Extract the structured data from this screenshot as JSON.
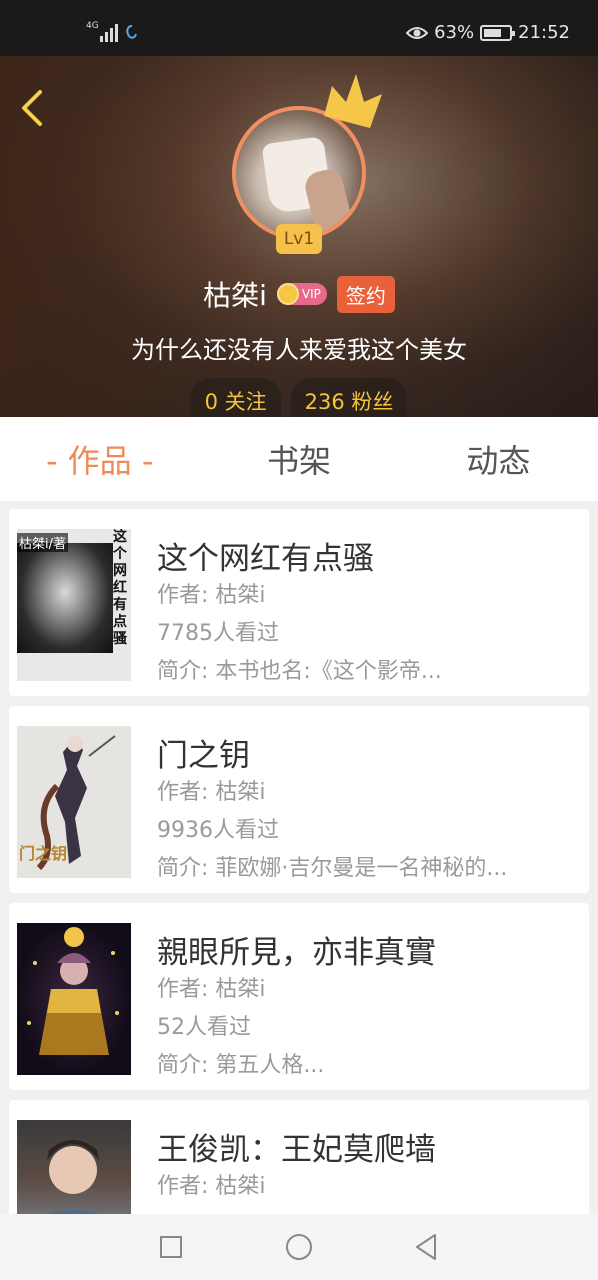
{
  "status_bar": {
    "network": "4G",
    "eye_percent": "63%",
    "time": "21:52"
  },
  "profile": {
    "level": "Lv1",
    "name": "枯桀i",
    "vip_label": "VIP",
    "sign_badge": "签约",
    "bio": "为什么还没有人来爱我这个美女",
    "follow": "0 关注",
    "fans": "236 粉丝"
  },
  "tabs": [
    {
      "label": "- 作品 -",
      "active": true
    },
    {
      "label": "书架",
      "active": false
    },
    {
      "label": "动态",
      "active": false
    }
  ],
  "books": [
    {
      "title": "这个网红有点骚",
      "author": "作者: 枯桀i",
      "views": "7785人看过",
      "summary": "简介: 本书也名:《这个影帝...",
      "cover_author": "枯桀i/著",
      "cover_title": "这个网红有点骚"
    },
    {
      "title": "门之钥",
      "author": "作者: 枯桀i",
      "views": "9936人看过",
      "summary": "简介: 菲欧娜·吉尔曼是一名神秘的...",
      "cover_title": "门之钥"
    },
    {
      "title": "親眼所見，亦非真實",
      "author": "作者: 枯桀i",
      "views": "52人看过",
      "summary": "简介: 第五人格..."
    },
    {
      "title": "王俊凯：王妃莫爬墙",
      "author": "作者: 枯桀i"
    }
  ],
  "colors": {
    "accent": "#ef8b5a",
    "sign_badge": "#e8613a",
    "level_badge": "#f6c14a",
    "stats_text": "#f3c53a"
  },
  "icons": {
    "back": "chevron-left-icon",
    "crown": "crown-icon",
    "nav_recent": "square-icon",
    "nav_home": "circle-icon",
    "nav_back": "triangle-back-icon"
  }
}
